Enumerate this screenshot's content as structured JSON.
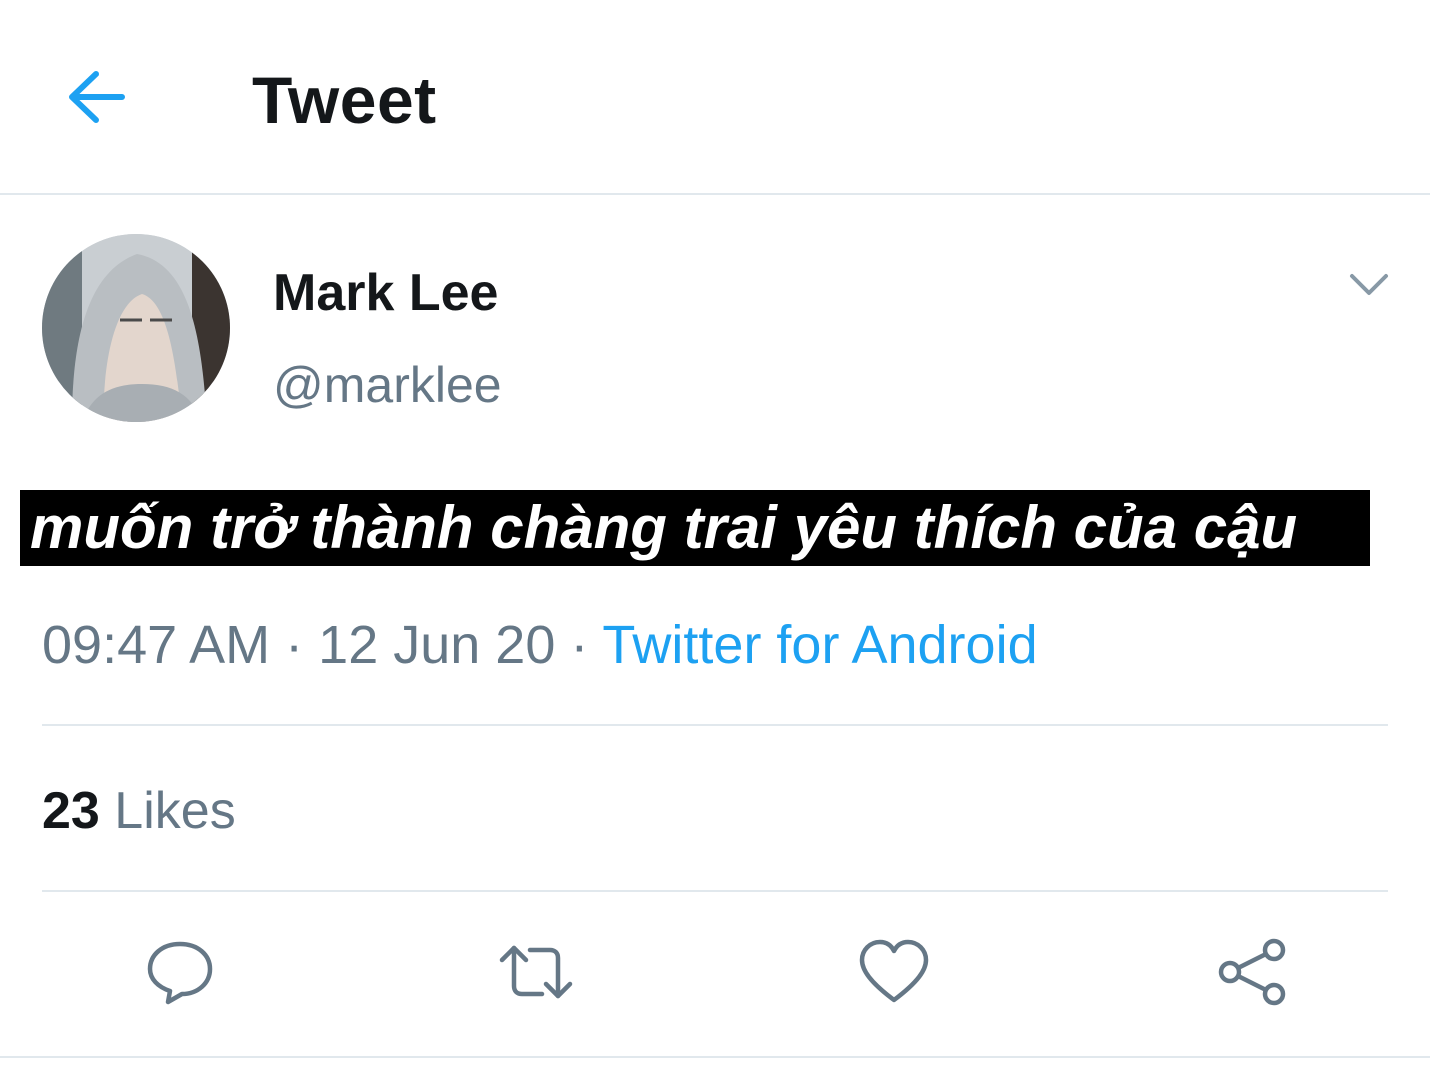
{
  "header": {
    "title": "Tweet",
    "back_icon": "arrow-left-icon"
  },
  "tweet": {
    "author": {
      "display_name": "Mark Lee",
      "handle": "@marklee"
    },
    "caption": "muốn trở thành chàng trai yêu thích của cậu",
    "time": "09:47 AM",
    "date": "12 Jun 20",
    "separator": "·",
    "source": "Twitter for Android",
    "likes": {
      "count": "23",
      "label": "Likes"
    },
    "actions": [
      "reply-icon",
      "retweet-icon",
      "like-icon",
      "share-icon"
    ]
  },
  "colors": {
    "accent": "#1da1f2",
    "text_primary": "#14171a",
    "text_secondary": "#657786",
    "divider": "#e1e8ed",
    "action_icon": "#657786"
  }
}
